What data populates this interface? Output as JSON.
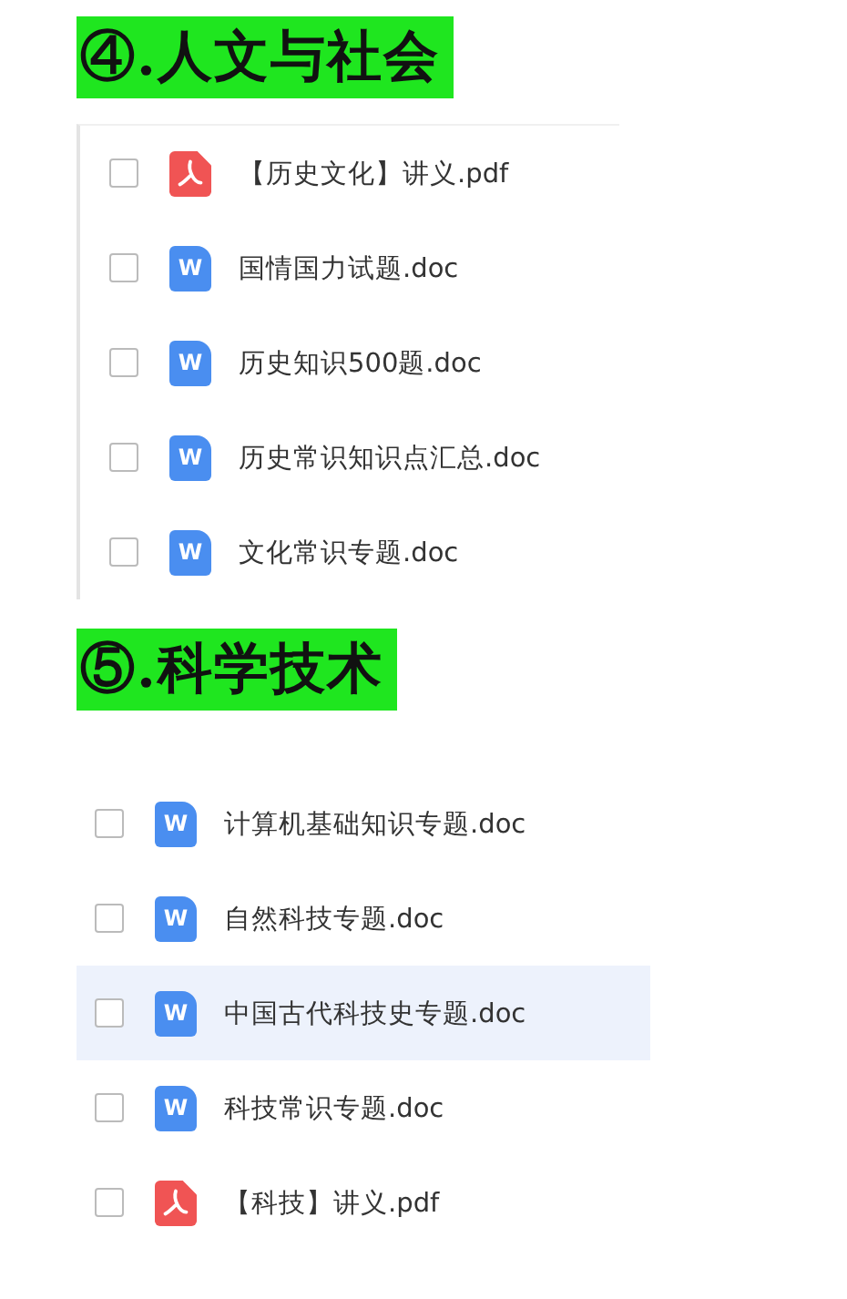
{
  "sections": [
    {
      "heading": "④.人文与社会",
      "bordered": true,
      "files": [
        {
          "kind": "pdf",
          "name": "【历史文化】讲义.pdf",
          "checked": false,
          "selected": false
        },
        {
          "kind": "doc",
          "icon_text": "W",
          "name": "国情国力试题.doc",
          "checked": false,
          "selected": false
        },
        {
          "kind": "doc",
          "icon_text": "W",
          "name": "历史知识500题.doc",
          "checked": false,
          "selected": false
        },
        {
          "kind": "doc",
          "icon_text": "W",
          "name": "历史常识知识点汇总.doc",
          "checked": false,
          "selected": false
        },
        {
          "kind": "doc",
          "icon_text": "W",
          "name": "文化常识专题.doc",
          "checked": false,
          "selected": false
        }
      ]
    },
    {
      "heading": "⑤.科学技术",
      "bordered": false,
      "files": [
        {
          "kind": "doc",
          "icon_text": "W",
          "name": "计算机基础知识专题.doc",
          "checked": false,
          "selected": false
        },
        {
          "kind": "doc",
          "icon_text": "W",
          "name": "自然科技专题.doc",
          "checked": false,
          "selected": false
        },
        {
          "kind": "doc",
          "icon_text": "W",
          "name": "中国古代科技史专题.doc",
          "checked": false,
          "selected": true
        },
        {
          "kind": "doc",
          "icon_text": "W",
          "name": "科技常识专题.doc",
          "checked": false,
          "selected": false
        },
        {
          "kind": "pdf",
          "name": "【科技】讲义.pdf",
          "checked": false,
          "selected": false
        }
      ]
    }
  ]
}
